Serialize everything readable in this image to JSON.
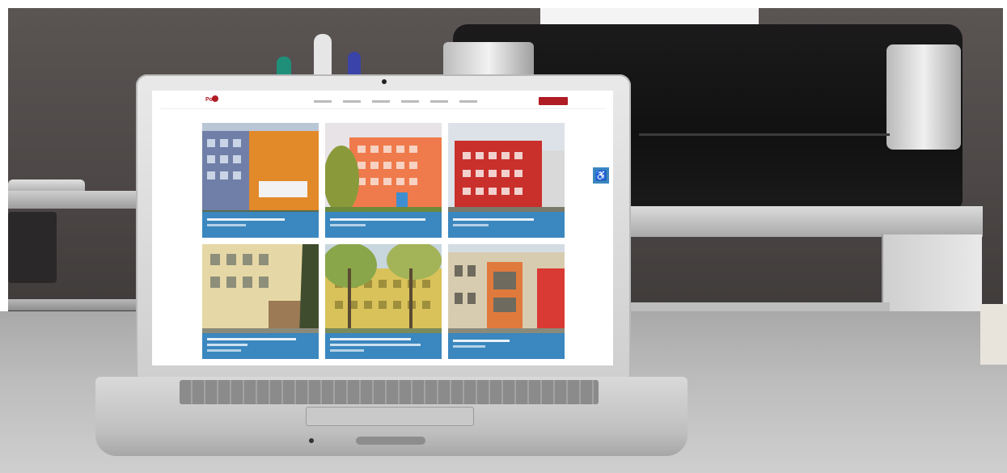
{
  "scene": {
    "wall_color": "#4d4847",
    "desk_color": "#bdbdbd",
    "device": "laptop",
    "background_objects": [
      "printer",
      "shelf",
      "mug",
      "pens"
    ]
  },
  "website": {
    "accent_color": "#3b87bf",
    "brand_color": "#b01c24",
    "logo_text": "PoP",
    "tiles": [
      {
        "image": "school-building-orange-panel"
      },
      {
        "image": "school-building-orange-facade"
      },
      {
        "image": "school-building-red-facade"
      },
      {
        "image": "school-building-yellow"
      },
      {
        "image": "school-building-yellow-trees"
      },
      {
        "image": "school-building-beige-orange"
      }
    ],
    "accessibility_icon": "wheelchair-icon"
  }
}
